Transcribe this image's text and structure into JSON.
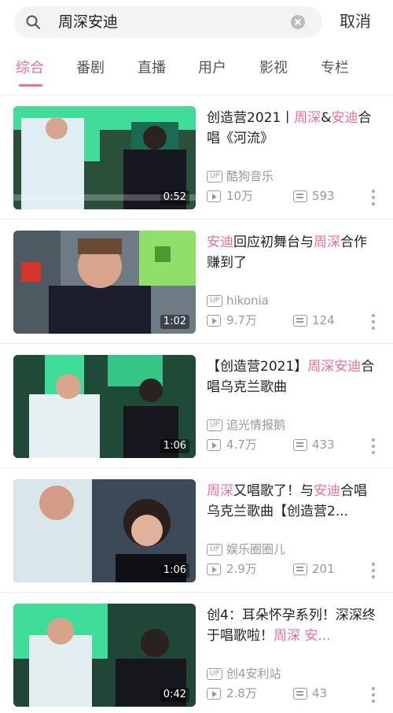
{
  "search": {
    "query": "周深安迪",
    "cancel_label": "取消"
  },
  "tabs": [
    {
      "label": "综合",
      "active": true
    },
    {
      "label": "番剧",
      "active": false
    },
    {
      "label": "直播",
      "active": false
    },
    {
      "label": "用户",
      "active": false
    },
    {
      "label": "影视",
      "active": false
    },
    {
      "label": "专栏",
      "active": false
    }
  ],
  "colors": {
    "accent": "#f06f99",
    "meta_text": "#999999"
  },
  "icons": {
    "search": "search-icon",
    "clear": "clear-icon",
    "uploader": "up-badge-icon",
    "plays": "play-count-icon",
    "danmaku": "danmaku-icon",
    "more": "more-vertical-icon"
  },
  "up_badge": "UP",
  "results": [
    {
      "title_parts": [
        {
          "text": "创造营2021丨",
          "hl": false
        },
        {
          "text": "周深",
          "hl": true
        },
        {
          "text": "&",
          "hl": false
        },
        {
          "text": "安迪",
          "hl": true
        },
        {
          "text": "合唱《河流》",
          "hl": false
        }
      ],
      "duration": "0:52",
      "uploader": "酷狗音乐",
      "views": "10万",
      "comments": "593"
    },
    {
      "title_parts": [
        {
          "text": "安迪",
          "hl": true
        },
        {
          "text": "回应初舞台与",
          "hl": false
        },
        {
          "text": "周深",
          "hl": true
        },
        {
          "text": "合作赚到了",
          "hl": false
        }
      ],
      "duration": "1:02",
      "uploader": "hikonia",
      "views": "9.7万",
      "comments": "124"
    },
    {
      "title_parts": [
        {
          "text": "【创造营2021】",
          "hl": false
        },
        {
          "text": "周深安迪",
          "hl": true
        },
        {
          "text": "合唱乌克兰歌曲",
          "hl": false
        }
      ],
      "duration": "1:06",
      "uploader": "追光情报鹅",
      "views": "4.7万",
      "comments": "433"
    },
    {
      "title_parts": [
        {
          "text": "周深",
          "hl": true
        },
        {
          "text": "又唱歌了！与",
          "hl": false
        },
        {
          "text": "安迪",
          "hl": true
        },
        {
          "text": "合唱乌克兰歌曲【创造营2...",
          "hl": false
        }
      ],
      "duration": "1:06",
      "uploader": "娱乐圈圈儿",
      "views": "2.9万",
      "comments": "201"
    },
    {
      "title_parts": [
        {
          "text": "创4：耳朵怀孕系列！深深终于唱歌啦！",
          "hl": false
        },
        {
          "text": "周深",
          "hl": true
        },
        {
          "text": " 安...",
          "hl": true
        }
      ],
      "duration": "0:42",
      "uploader": "创4安利站",
      "views": "2.8万",
      "comments": "43"
    }
  ]
}
